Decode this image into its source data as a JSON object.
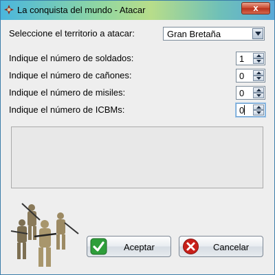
{
  "window": {
    "title": "La conquista del mundo - Atacar",
    "close_label": "x"
  },
  "form": {
    "territory_label": "Seleccione el territorio a atacar:",
    "territory_value": "Gran Bretaña",
    "soldiers_label": "Indique el número de soldados:",
    "soldiers_value": "1",
    "cannons_label": "Indique el número de cañones:",
    "cannons_value": "0",
    "missiles_label": "Indique el número de misiles:",
    "missiles_value": "0",
    "icbms_label": "Indique el número de ICBMs:",
    "icbms_value": "0"
  },
  "buttons": {
    "accept_label": "Aceptar",
    "cancel_label": "Cancelar"
  },
  "colors": {
    "accept_icon": "#2e9e3a",
    "cancel_icon": "#c8201a"
  }
}
